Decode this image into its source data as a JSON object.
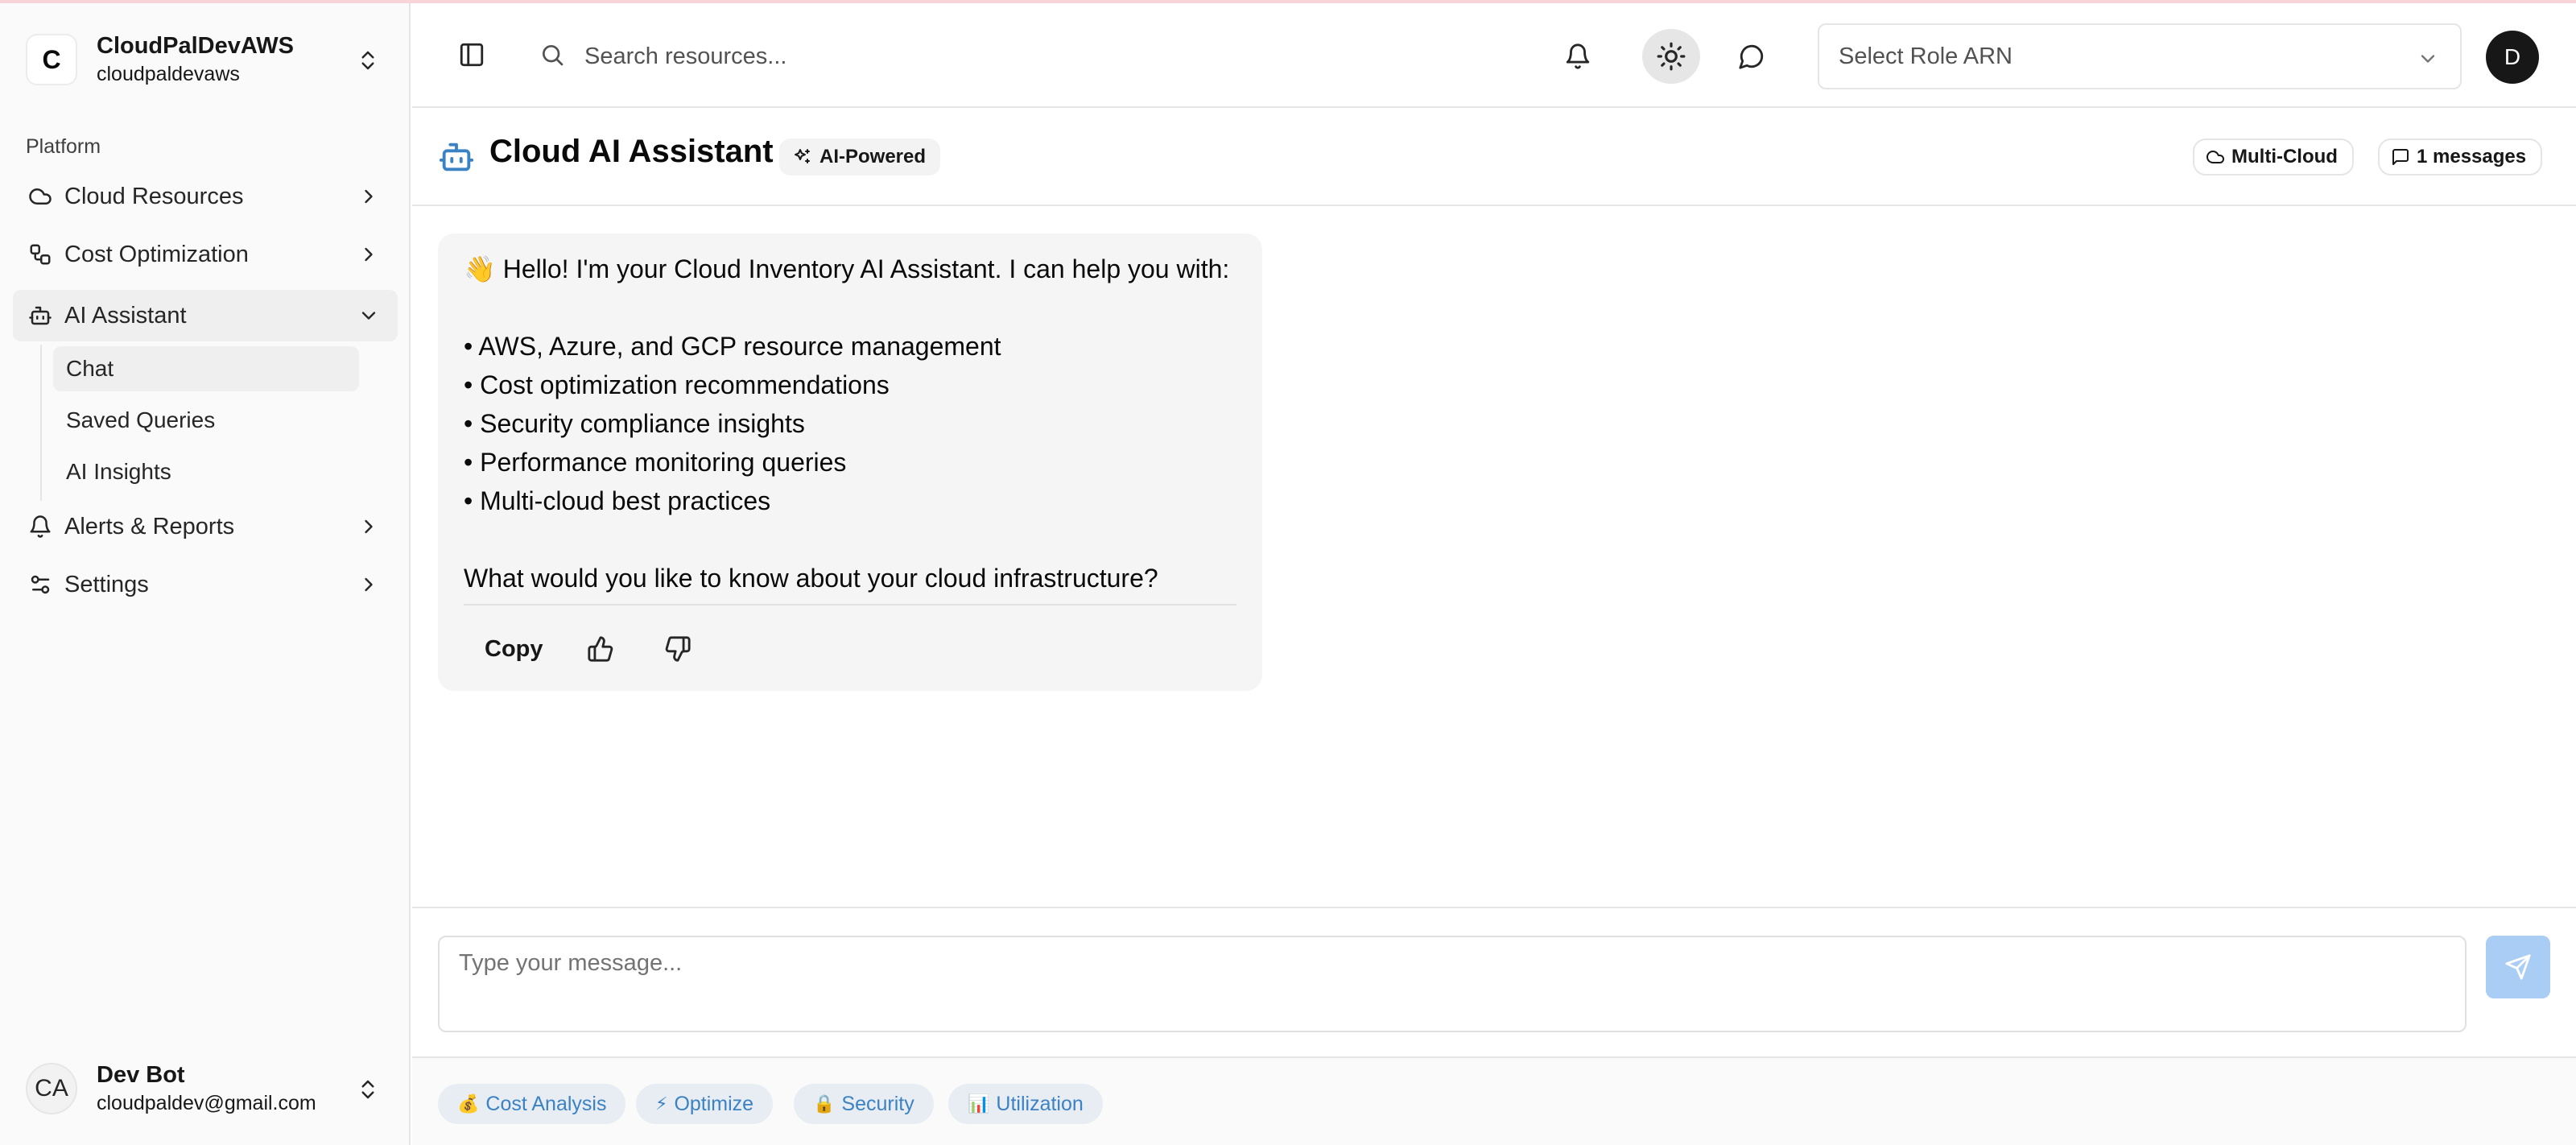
{
  "org": {
    "logo_letter": "C",
    "name": "CloudPalDevAWS",
    "slug": "cloudpaldevaws"
  },
  "sidebar": {
    "group_label": "Platform",
    "items": [
      {
        "label": "Cloud Resources",
        "icon": "cloud-icon"
      },
      {
        "label": "Cost Optimization",
        "icon": "workflow-icon"
      },
      {
        "label": "AI Assistant",
        "icon": "bot-icon",
        "expanded": true
      },
      {
        "label": "Alerts & Reports",
        "icon": "bell-icon"
      },
      {
        "label": "Settings",
        "icon": "sliders-icon"
      }
    ],
    "sub_items": [
      {
        "label": "Chat",
        "active": true
      },
      {
        "label": "Saved Queries"
      },
      {
        "label": "AI Insights"
      }
    ]
  },
  "user": {
    "initials": "CA",
    "name": "Dev Bot",
    "email": "cloudpaldev@gmail.com"
  },
  "header": {
    "search_placeholder": "Search resources...",
    "role_placeholder": "Select Role ARN",
    "avatar_letter": "D"
  },
  "page": {
    "title": "Cloud AI Assistant",
    "badge": "AI-Powered",
    "pill_cloud": "Multi-Cloud",
    "pill_messages": "1 messages"
  },
  "message": {
    "greeting": "👋 Hello! I'm your Cloud Inventory AI Assistant. I can help you with:",
    "bullets": [
      "• AWS, Azure, and GCP resource management",
      "• Cost optimization recommendations",
      "• Security compliance insights",
      "• Performance monitoring queries",
      "• Multi-cloud best practices"
    ],
    "closing": "What would you like to know about your cloud infrastructure?",
    "copy_label": "Copy"
  },
  "composer": {
    "placeholder": "Type your message..."
  },
  "suggestions": [
    {
      "emoji": "💰",
      "label": "Cost Analysis"
    },
    {
      "emoji": "⚡",
      "label": "Optimize"
    },
    {
      "emoji": "🔒",
      "label": "Security"
    },
    {
      "emoji": "📊",
      "label": "Utilization"
    }
  ],
  "colors": {
    "accent_blue": "#3b82c4",
    "send_disabled": "#a9cdf5",
    "chip_bg": "#e8edf3"
  }
}
